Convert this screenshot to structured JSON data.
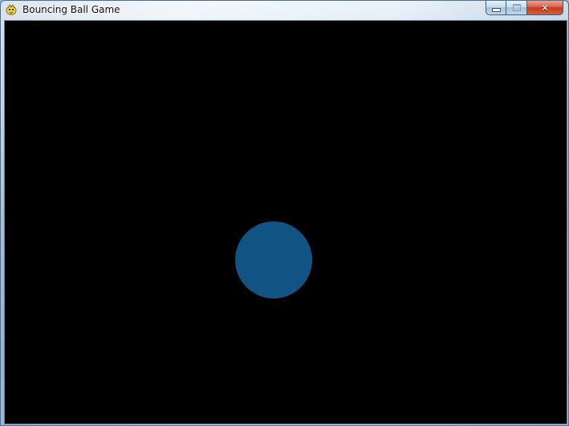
{
  "window": {
    "title": "Bouncing Ball Game",
    "icon": "pygame-snake-icon",
    "controls": {
      "minimize_icon": "minimize-icon",
      "maximize_icon": "maximize-icon",
      "close_icon": "close-icon",
      "close_glyph": "✕"
    }
  },
  "game": {
    "background_color": "#000000",
    "ball_color": "#115484"
  }
}
